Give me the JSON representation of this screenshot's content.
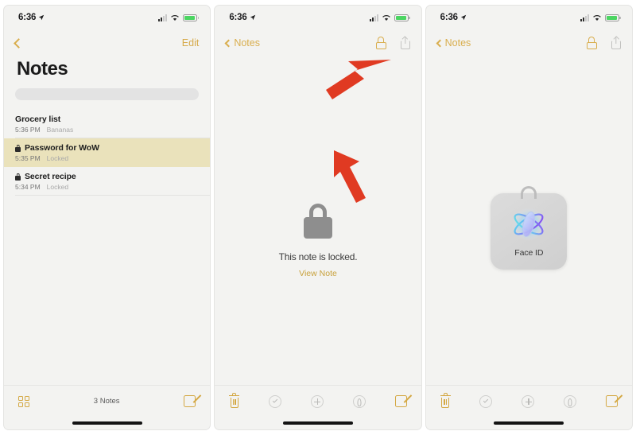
{
  "status_bar": {
    "time": "6:36",
    "location_icon": "location-arrow-icon",
    "signal_icon": "cellular-signal-icon",
    "wifi_icon": "wifi-icon",
    "battery_icon": "battery-icon",
    "battery_color": "#4cd562"
  },
  "colors": {
    "accent_gold": "#d4a843",
    "highlight_row": "#eae2bb",
    "arrow_red": "#e03a22",
    "panel_bg": "#f3f3f1",
    "lock_grey": "#8e8e8e"
  },
  "panel1": {
    "name": "notes-list-screen",
    "nav": {
      "back_icon": "chevron-left-icon",
      "edit_label": "Edit"
    },
    "title": "Notes",
    "search_placeholder": "",
    "notes": [
      {
        "title": "Grocery list",
        "time": "5:36 PM",
        "preview": "Bananas",
        "locked": false
      },
      {
        "title": "Password for WoW",
        "time": "5:35 PM",
        "preview": "Locked",
        "locked": true
      },
      {
        "title": "Secret recipe",
        "time": "5:34 PM",
        "preview": "Locked",
        "locked": true
      }
    ],
    "toolbar": {
      "grid_icon": "grid-view-icon",
      "count_label": "3 Notes",
      "compose_icon": "compose-icon"
    }
  },
  "panel2": {
    "name": "locked-note-screen",
    "nav": {
      "back_icon": "chevron-left-icon",
      "back_label": "Notes",
      "lock_icon": "lock-icon",
      "share_icon": "share-icon"
    },
    "locked_message": "This note is locked.",
    "view_note_label": "View Note",
    "lock_icon_large": "padlock-icon",
    "annotations": [
      {
        "name": "arrow-to-lock-button",
        "target": "lock-icon"
      },
      {
        "name": "arrow-to-view-note",
        "target": "view-note-link"
      }
    ],
    "toolbar": {
      "trash_icon": "trash-icon",
      "checklist_icon": "checklist-circle-icon",
      "add_icon": "plus-circle-icon",
      "markup_icon": "markup-circle-icon",
      "compose_icon": "compose-icon"
    }
  },
  "panel3": {
    "name": "face-id-auth-screen",
    "nav": {
      "back_icon": "chevron-left-icon",
      "back_label": "Notes",
      "lock_icon": "lock-icon",
      "share_icon": "share-icon"
    },
    "faceid": {
      "glyph_icon": "face-id-icon",
      "label": "Face ID",
      "shackle_icon": "padlock-shackle-icon"
    },
    "toolbar": {
      "trash_icon": "trash-icon",
      "checklist_icon": "checklist-circle-icon",
      "add_icon": "plus-circle-icon",
      "markup_icon": "markup-circle-icon",
      "compose_icon": "compose-icon"
    }
  }
}
